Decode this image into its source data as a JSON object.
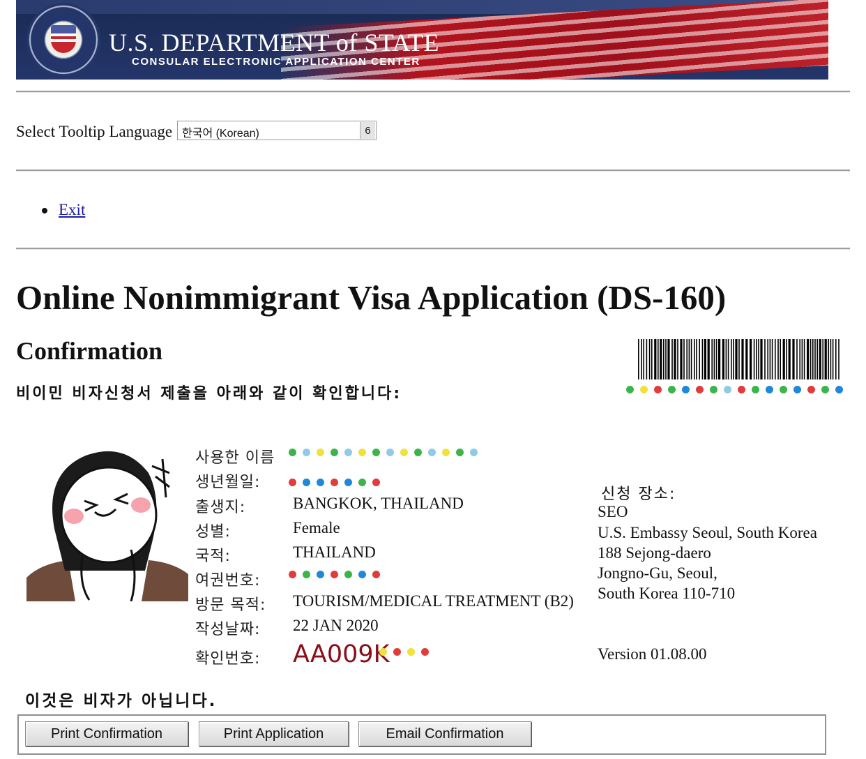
{
  "header": {
    "title": "U.S. DEPARTMENT of STATE",
    "subtitle": "CONSULAR ELECTRONIC APPLICATION CENTER"
  },
  "tooltip_language": {
    "label": "Select Tooltip Language",
    "selected": "한국어 (Korean)",
    "arrow_glyph": "6"
  },
  "nav": {
    "exit_label": "Exit"
  },
  "page": {
    "title": "Online Nonimmigrant Visa Application (DS-160)",
    "subtitle": "Confirmation",
    "intro": "비이민 비자신청서 제출을 아래와 같이 확인합니다:"
  },
  "fields": [
    {
      "label": "사용한 이름",
      "value": ""
    },
    {
      "label": "생년월일:",
      "value": ""
    },
    {
      "label": "출생지:",
      "value": "BANGKOK, THAILAND"
    },
    {
      "label": "성별:",
      "value": "Female"
    },
    {
      "label": "국적:",
      "value": "THAILAND"
    },
    {
      "label": "여권번호:",
      "value": ""
    },
    {
      "label": "방문 목적:",
      "value": "TOURISM/MEDICAL TREATMENT (B2)"
    },
    {
      "label": "작성날짜:",
      "value": "22 JAN 2020"
    },
    {
      "label": "확인번호:",
      "value": "AA009K"
    }
  ],
  "location": {
    "label": "신청 장소:",
    "code": "SEO",
    "lines": [
      "U.S. Embassy Seoul, South Korea",
      "188 Sejong-daero",
      "Jongno-Gu, Seoul,",
      "South Korea 110-710"
    ]
  },
  "version": "Version 01.08.00",
  "notice": "이것은 비자가 아닙니다.",
  "buttons": {
    "print_confirmation": "Print Confirmation",
    "print_application": "Print Application",
    "email_confirmation": "Email Confirmation"
  },
  "icons": {
    "seal": "department-of-state-seal-icon",
    "barcode": "barcode-icon",
    "photo": "applicant-photo-sticker-icon"
  },
  "colors": {
    "link": "#1a1aa6",
    "confirmation_number": "#8b0e18",
    "banner_blue": "#1c2c57",
    "banner_red": "#b3141e"
  }
}
